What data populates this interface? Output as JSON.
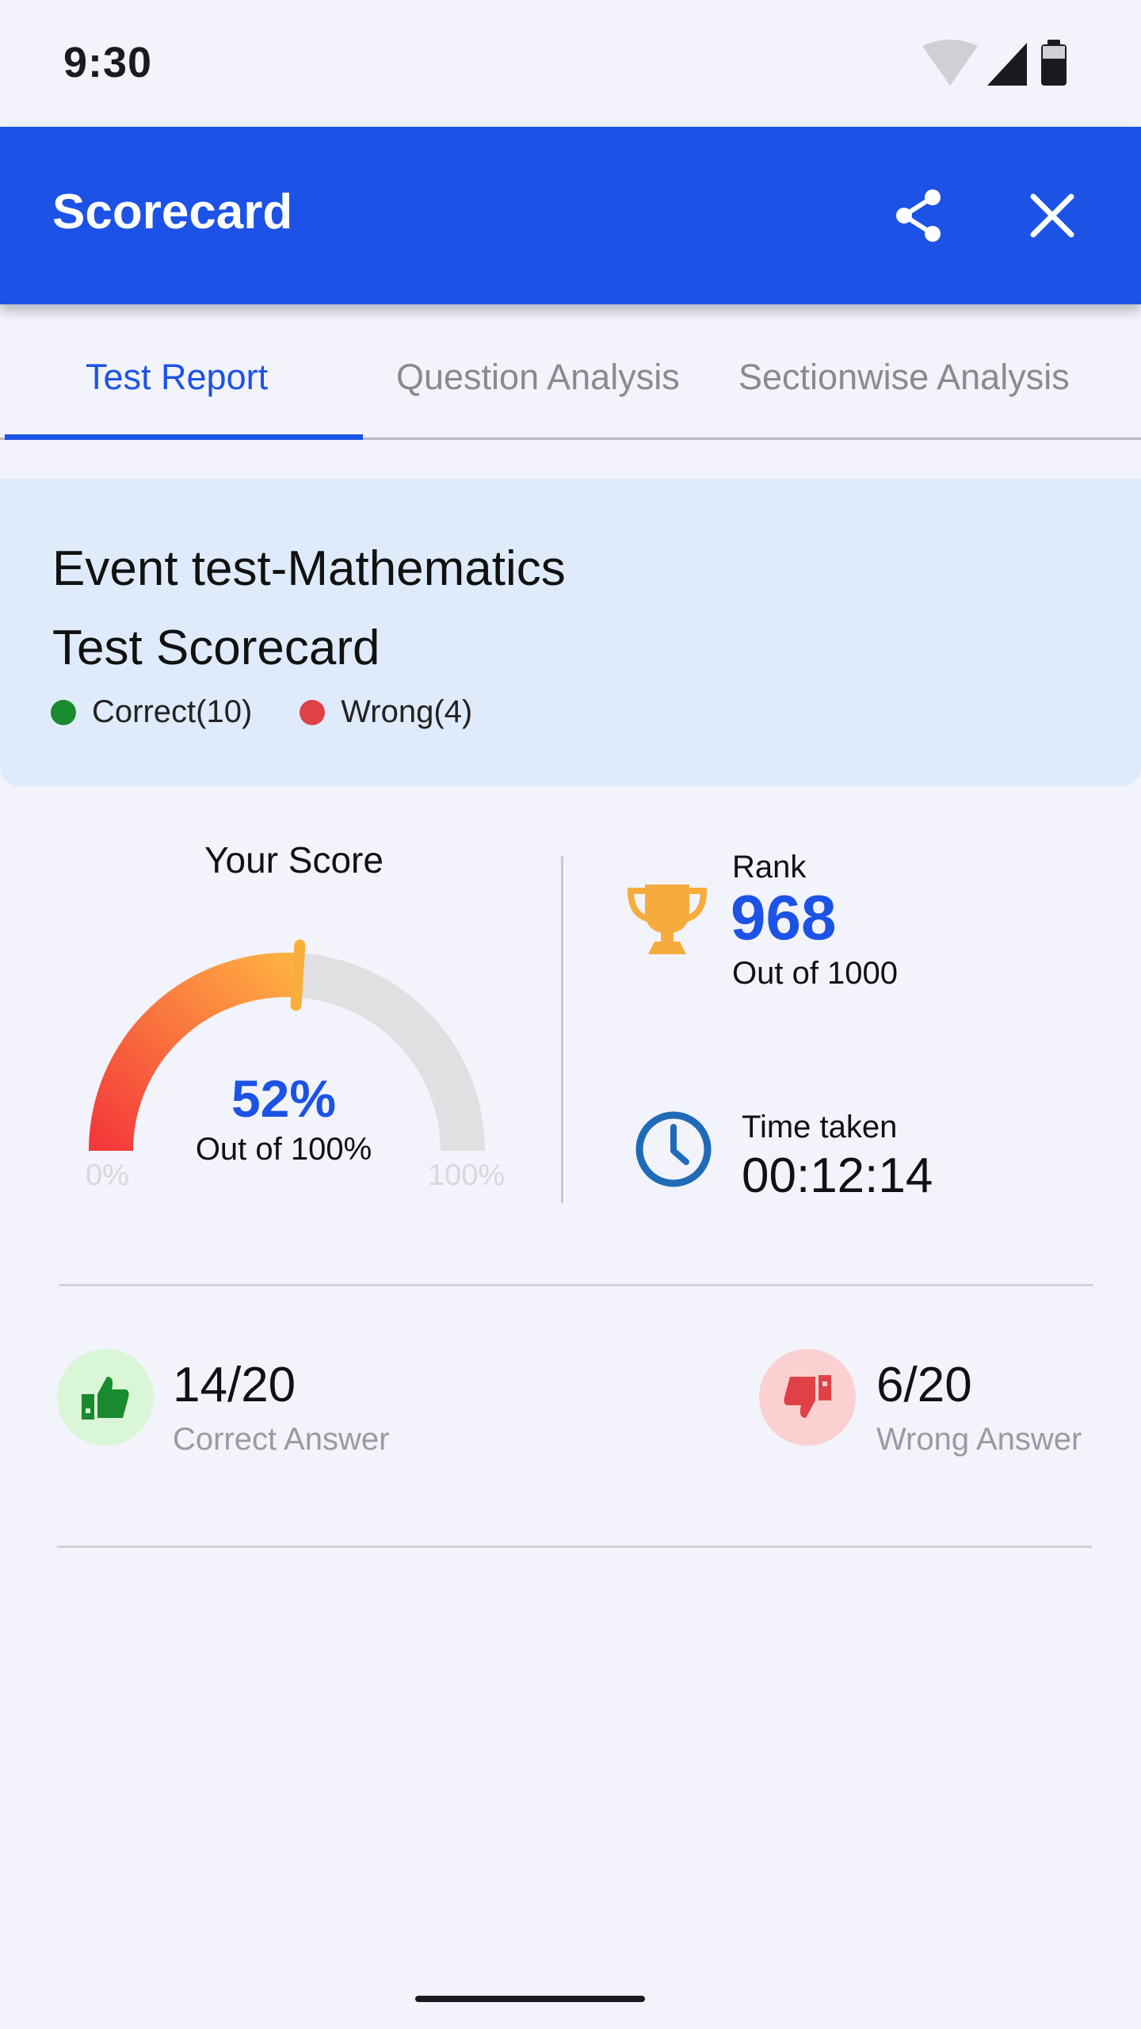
{
  "status_bar": {
    "time": "9:30"
  },
  "app_bar": {
    "title": "Scorecard"
  },
  "tabs": [
    {
      "label": "Test Report",
      "active": true
    },
    {
      "label": "Question Analysis",
      "active": false
    },
    {
      "label": "Sectionwise Analysis",
      "active": false
    }
  ],
  "header": {
    "exam_name": "Event test-Mathematics",
    "subtitle": "Test Scorecard",
    "legend": [
      {
        "label": "Correct(10)",
        "color": "#1a8a2e"
      },
      {
        "label": "Wrong(4)",
        "color": "#df4146"
      }
    ]
  },
  "score": {
    "title": "Your Score",
    "percent_text": "52%",
    "percent_value": 0.52,
    "out_of": "Out of 100%",
    "min_label": "0%",
    "max_label": "100%"
  },
  "rank": {
    "label": "Rank",
    "value": "968",
    "out_of": "Out of 1000"
  },
  "time": {
    "label": "Time taken",
    "value": "00:12:14"
  },
  "answers": {
    "correct": {
      "value": "14/20",
      "label": "Correct Answer"
    },
    "wrong": {
      "value": "6/20",
      "label": "Wrong Answer"
    }
  },
  "colors": {
    "primary": "#1c53e6",
    "gauge_start": "#f43a3a",
    "gauge_end": "#ffae42",
    "gauge_track": "#e0e0e2",
    "correct": "#1a8a2e",
    "wrong": "#df4146"
  },
  "icons": {
    "share": "share-icon",
    "close": "close-icon",
    "trophy": "trophy-icon",
    "clock": "clock-icon",
    "thumbs_up": "thumbs-up-icon",
    "thumbs_down": "thumbs-down-icon"
  }
}
